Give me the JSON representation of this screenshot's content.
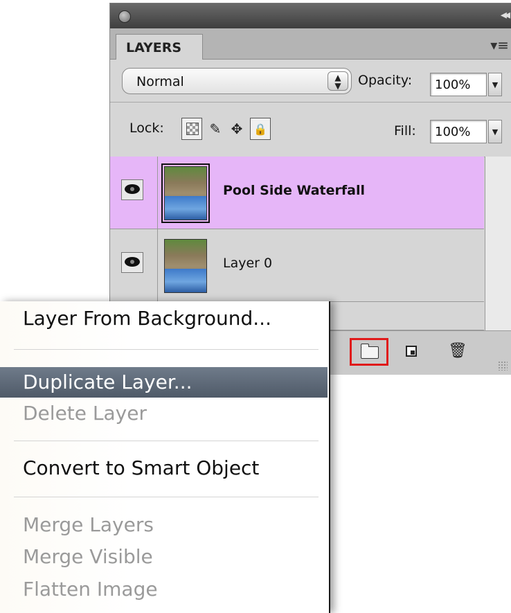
{
  "panel": {
    "tab_label": "LAYERS",
    "blend_mode": "Normal",
    "opacity_label": "Opacity:",
    "opacity_value": "100%",
    "lock_label": "Lock:",
    "fill_label": "Fill:",
    "fill_value": "100%",
    "layers": [
      {
        "name": "Pool Side Waterfall",
        "selected": true,
        "highlight_color": "#e6b6f8"
      },
      {
        "name": "Layer 0",
        "selected": false
      }
    ],
    "bottom_highlight_color": "#e01a1a"
  },
  "context_menu": {
    "items": [
      {
        "label": "Layer From Background...",
        "enabled": true
      },
      {
        "label": "Duplicate Layer...",
        "enabled": true,
        "highlighted": true
      },
      {
        "label": "Delete Layer",
        "enabled": false
      },
      {
        "label": "Convert to Smart Object",
        "enabled": true
      },
      {
        "label": "Merge Layers",
        "enabled": false
      },
      {
        "label": "Merge Visible",
        "enabled": false
      },
      {
        "label": "Flatten Image",
        "enabled": false
      }
    ]
  }
}
